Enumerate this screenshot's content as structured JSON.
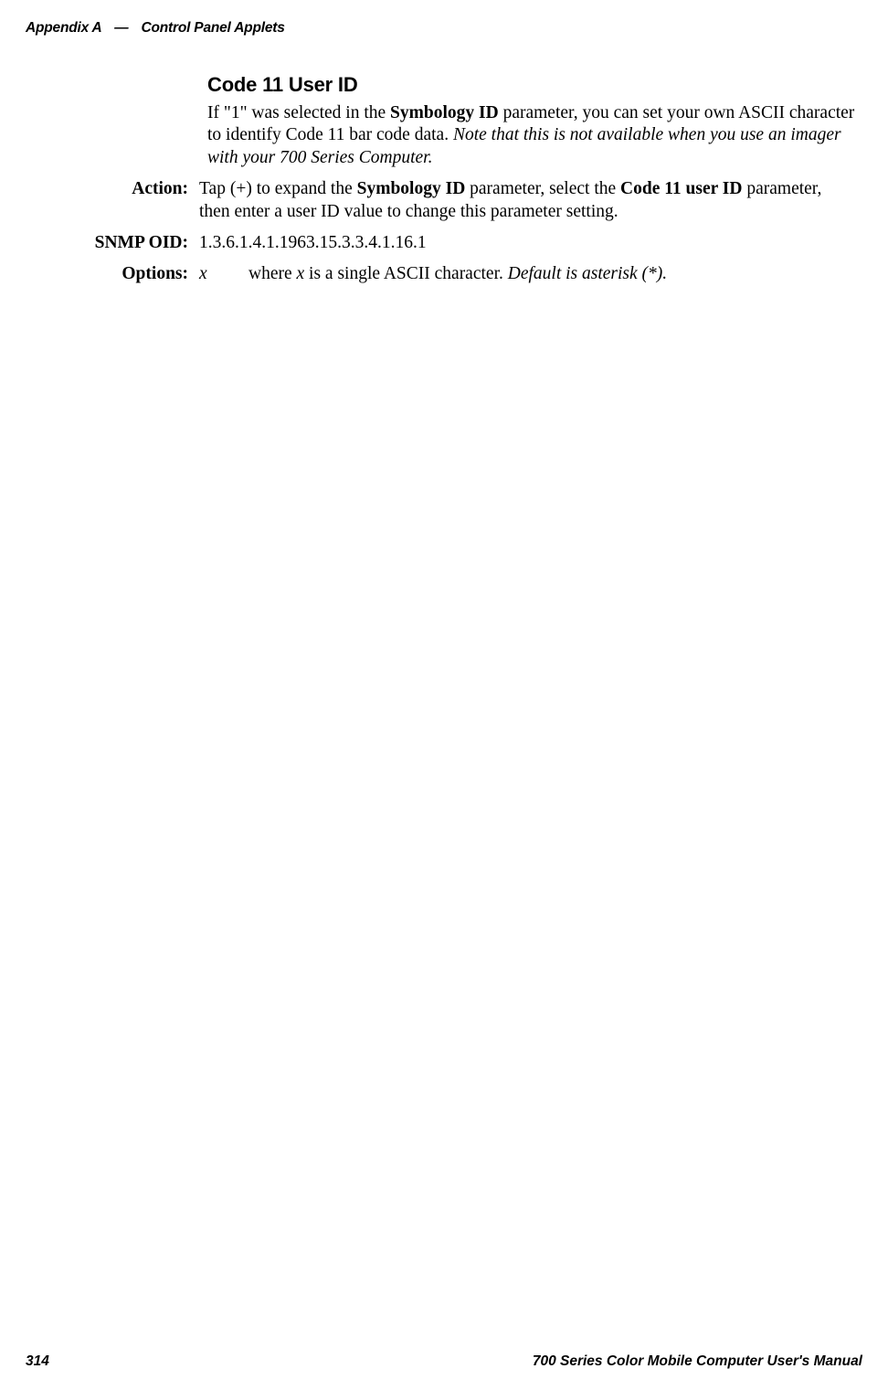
{
  "header": {
    "appendix": "Appendix  A",
    "em_dash": "—",
    "title": "Control Panel Applets"
  },
  "section": {
    "title": "Code 11 User ID",
    "intro_prefix": "If \"1\" was selected in the ",
    "intro_bold1": "Symbology ID",
    "intro_mid": " parameter, you can set your own ASCII character to identify Code 11 bar code data. ",
    "intro_italic": "Note that this is not available when you use an imager with your 700 Series Computer."
  },
  "rows": {
    "action": {
      "label": "Action:",
      "prefix": "Tap (+) to expand the ",
      "bold1": "Symbology ID",
      "mid": " parameter, select the ",
      "bold2": "Code 11 user ID",
      "suffix": " parameter, then enter a user ID value to change this parameter setting."
    },
    "snmp": {
      "label": "SNMP OID:",
      "value": "1.3.6.1.4.1.1963.15.3.3.4.1.16.1"
    },
    "options": {
      "label": "Options:",
      "x": "x",
      "prefix": "where ",
      "italic_x": "x",
      "mid": " is a single ASCII character. ",
      "italic_suffix": "Default is asterisk (*)."
    }
  },
  "footer": {
    "page": "314",
    "manual": "700 Series Color Mobile Computer User's Manual"
  }
}
